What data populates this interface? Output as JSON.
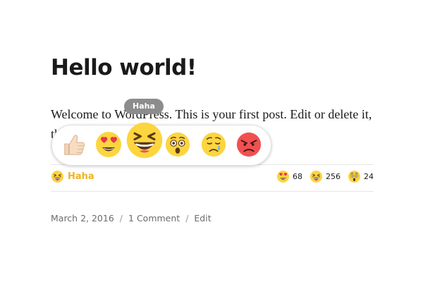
{
  "post": {
    "title": "Hello world!",
    "body": "Welcome to WordPress. This is your first post. Edit or delete it, then start writing!"
  },
  "reaction_picker": {
    "tooltip": "Haha",
    "options": [
      {
        "name": "like",
        "icon": "thumbs-up-icon"
      },
      {
        "name": "love",
        "icon": "heart-eyes-icon"
      },
      {
        "name": "haha",
        "icon": "laughing-face-icon"
      },
      {
        "name": "wow",
        "icon": "surprised-face-icon"
      },
      {
        "name": "sad",
        "icon": "crying-face-icon"
      },
      {
        "name": "angry",
        "icon": "angry-face-icon"
      }
    ],
    "hovered": "haha"
  },
  "my_reaction": {
    "label": "Haha",
    "icon": "laughing-face-icon",
    "color": "#f0b323"
  },
  "reaction_counts": [
    {
      "icon": "heart-eyes-icon",
      "count": "68"
    },
    {
      "icon": "laughing-face-icon",
      "count": "256"
    },
    {
      "icon": "surprised-face-icon",
      "count": "24"
    }
  ],
  "meta": {
    "date": "March 2, 2016",
    "separator": "/",
    "comments": "1 Comment",
    "edit": "Edit"
  },
  "colors": {
    "emoji_yellow": "#fcd53f",
    "angry_red": "#f05050",
    "label_gold": "#f0b323",
    "meta_gray": "#6b6b6b"
  }
}
